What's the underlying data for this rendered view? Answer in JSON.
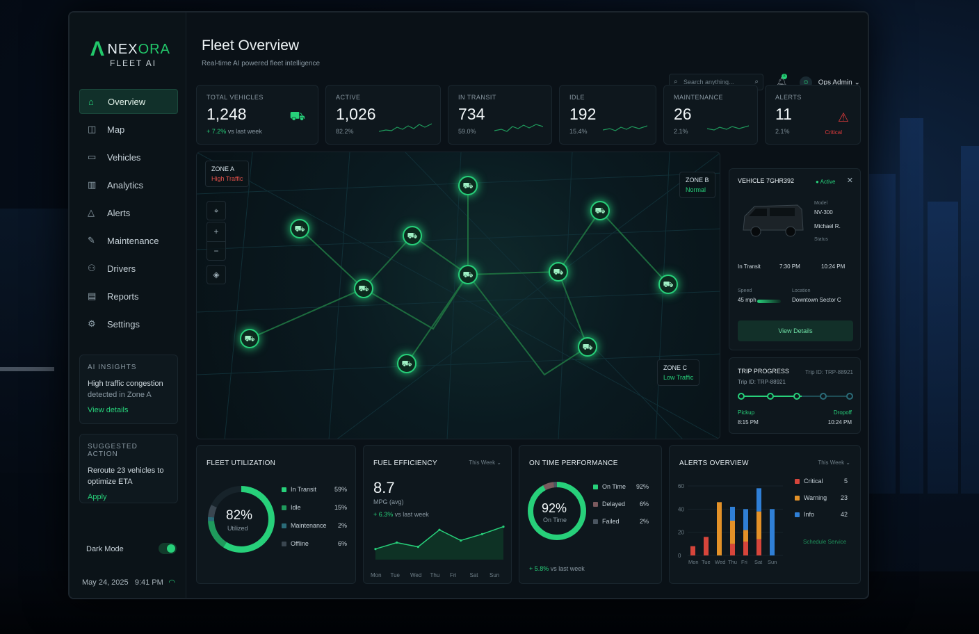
{
  "brand": {
    "mark": "Λ",
    "name_a": "NEX",
    "name_b": "ORA",
    "sub": "FLEET AI"
  },
  "nav": [
    {
      "icon": "⌂",
      "label": "Overview",
      "active": true
    },
    {
      "icon": "◫",
      "label": "Map"
    },
    {
      "icon": "▭",
      "label": "Vehicles"
    },
    {
      "icon": "▥",
      "label": "Analytics"
    },
    {
      "icon": "△",
      "label": "Alerts"
    },
    {
      "icon": "✎",
      "label": "Maintenance"
    },
    {
      "icon": "⚇",
      "label": "Drivers"
    },
    {
      "icon": "▤",
      "label": "Reports"
    },
    {
      "icon": "⚙",
      "label": "Settings"
    }
  ],
  "insights": {
    "heading": "AI INSIGHTS",
    "line1": "High traffic congestion",
    "line2": "detected in Zone A",
    "link": "View details"
  },
  "suggested": {
    "heading": "SUGGESTED ACTION",
    "line1": "Reroute 23 vehicles to",
    "line2": "optimize ETA",
    "link": "Apply"
  },
  "dark_mode_label": "Dark Mode",
  "datetime": {
    "date": "May 24, 2025",
    "time": "9:41 PM"
  },
  "header": {
    "title": "Fleet Overview",
    "subtitle": "Real-time AI powered fleet intelligence",
    "search_placeholder": "Search anything...",
    "notif_count": "8",
    "user": "Ops Admin"
  },
  "stats": [
    {
      "label": "TOTAL VEHICLES",
      "value": "1,248",
      "trend_val": "+ 7.2%",
      "trend_text": " vs last week"
    },
    {
      "label": "ACTIVE",
      "value": "1,026",
      "pct": "82.2%"
    },
    {
      "label": "IN TRANSIT",
      "value": "734",
      "pct": "59.0%"
    },
    {
      "label": "IDLE",
      "value": "192",
      "pct": "15.4%"
    },
    {
      "label": "MAINTENANCE",
      "value": "26",
      "pct": "2.1%"
    },
    {
      "label": "ALERTS",
      "value": "11",
      "pct": "2.1%",
      "status": "Critical"
    }
  ],
  "zones": {
    "a": {
      "name": "ZONE A",
      "status": "High Traffic"
    },
    "b": {
      "name": "ZONE B",
      "status": "Normal"
    },
    "c": {
      "name": "ZONE C",
      "status": "Low Traffic"
    }
  },
  "vehicle": {
    "title": "VEHICLE 7GHR392",
    "status": "Active",
    "model_k": "Model",
    "model_v": "NV-300",
    "driver_v": "Michael R.",
    "state_k": "Status",
    "state_v": "In Transit",
    "dep_v": "7:30 PM",
    "eta_v": "10:24 PM",
    "speed_k": "Speed",
    "speed_v": "45 mph",
    "loc_k": "Location",
    "loc_v": "Downtown Sector C",
    "button": "View Details"
  },
  "trip": {
    "title": "TRIP PROGRESS",
    "ref": "Trip ID: TRP-88921",
    "id": "Trip ID: TRP-88921",
    "progress": 0.55,
    "pickup_k": "Pickup",
    "pickup_v": "8:15 PM",
    "drop_k": "Dropoff",
    "drop_v": "10:24 PM"
  },
  "utilization": {
    "title": "FLEET UTILIZATION",
    "center": "82%",
    "center_sub": "Utilized",
    "items": [
      {
        "label": "In Transit",
        "value": "59%",
        "color": "#27d07a"
      },
      {
        "label": "Idle",
        "value": "15%",
        "color": "#1f9a5c"
      },
      {
        "label": "Maintenance",
        "value": "2%",
        "color": "#2a6b78"
      },
      {
        "label": "Offline",
        "value": "6%",
        "color": "#3a4650"
      }
    ]
  },
  "fuel": {
    "title": "FUEL EFFICIENCY",
    "period": "This Week ⌄",
    "value": "8.7",
    "unit": "MPG (avg)",
    "trend_val": "+ 6.3%",
    "trend_text": " vs last week"
  },
  "ontime": {
    "title": "ON TIME PERFORMANCE",
    "center": "92%",
    "center_sub": "On Time",
    "trend_val": "+ 5.8%",
    "trend_text": " vs last week",
    "items": [
      {
        "label": "On Time",
        "value": "92%",
        "color": "#27d07a"
      },
      {
        "label": "Delayed",
        "value": "6%",
        "color": "#7a5a5e"
      },
      {
        "label": "Failed",
        "value": "2%",
        "color": "#4a5560"
      }
    ]
  },
  "alerts_overview": {
    "title": "ALERTS OVERVIEW",
    "period": "This Week ⌄",
    "action": "Schedule Service",
    "legend": [
      {
        "label": "Critical",
        "value": "5",
        "color": "#d6453b"
      },
      {
        "label": "Warning",
        "value": "23",
        "color": "#e39128"
      },
      {
        "label": "Info",
        "value": "42",
        "color": "#2f7fd6"
      }
    ]
  },
  "chart_data": [
    {
      "type": "line",
      "title": "FUEL EFFICIENCY",
      "categories": [
        "Mon",
        "Tue",
        "Wed",
        "Thu",
        "Fri",
        "Sat",
        "Sun"
      ],
      "series": [
        {
          "values": [
            6.8,
            7.4,
            7.0,
            8.6,
            7.6,
            8.2,
            8.9
          ]
        }
      ]
    },
    {
      "type": "bar",
      "title": "ALERTS OVERVIEW",
      "categories": [
        "Mon",
        "Tue",
        "Wed",
        "Thu",
        "Fri",
        "Sat",
        "Sun"
      ],
      "ylim": [
        0,
        60
      ],
      "yticks": [
        0,
        20,
        40,
        60
      ],
      "series": [
        {
          "name": "Critical",
          "color": "#d6453b",
          "values": [
            8,
            16,
            0,
            10,
            12,
            14,
            0
          ]
        },
        {
          "name": "Warning",
          "color": "#e39128",
          "values": [
            0,
            0,
            46,
            20,
            10,
            24,
            0
          ]
        },
        {
          "name": "Info",
          "color": "#2f7fd6",
          "values": [
            0,
            0,
            0,
            12,
            18,
            20,
            40
          ]
        }
      ]
    }
  ]
}
